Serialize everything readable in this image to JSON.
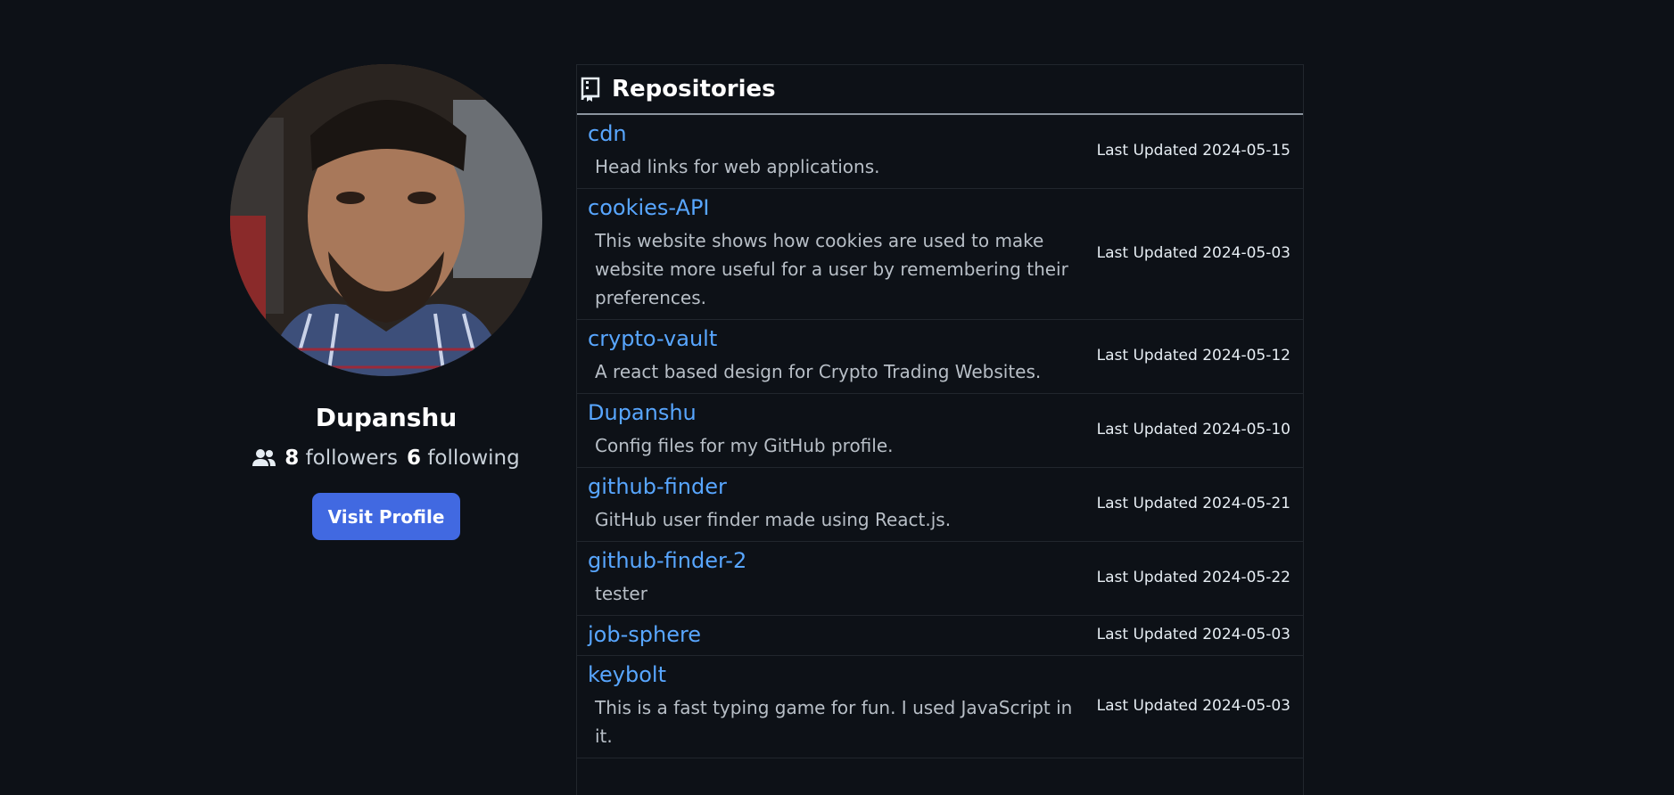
{
  "profile": {
    "username": "Dupanshu",
    "followers_count": "8",
    "followers_label": "followers",
    "following_count": "6",
    "following_label": "following",
    "visit_label": "Visit Profile"
  },
  "repos": {
    "title": "Repositories",
    "items": [
      {
        "name": "cdn",
        "description": "Head links for web applications.",
        "updated": "Last Updated 2024-05-15"
      },
      {
        "name": "cookies-API",
        "description": "This website shows how cookies are used to make website more useful for a user by remembering their preferences.",
        "updated": "Last Updated 2024-05-03"
      },
      {
        "name": "crypto-vault",
        "description": "A react based design for Crypto Trading Websites.",
        "updated": "Last Updated 2024-05-12"
      },
      {
        "name": "Dupanshu",
        "description": "Config files for my GitHub profile.",
        "updated": "Last Updated 2024-05-10"
      },
      {
        "name": "github-finder",
        "description": "GitHub user finder made using React.js.",
        "updated": "Last Updated 2024-05-21"
      },
      {
        "name": "github-finder-2",
        "description": "tester",
        "updated": "Last Updated 2024-05-22"
      },
      {
        "name": "job-sphere",
        "description": "",
        "updated": "Last Updated 2024-05-03"
      },
      {
        "name": "keybolt",
        "description": "This is a fast typing game for fun. I used JavaScript in it.",
        "updated": "Last Updated 2024-05-03"
      }
    ]
  },
  "colors": {
    "background": "#0d1117",
    "link": "#58a6ff",
    "button": "#4169e1"
  },
  "icons": {
    "people": "people-icon",
    "repo": "repo-icon"
  }
}
